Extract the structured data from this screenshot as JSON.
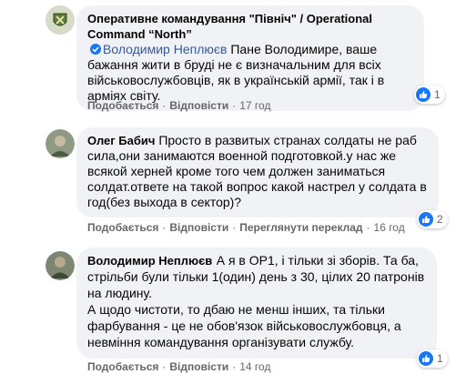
{
  "comments": [
    {
      "author": "Оперативне командування \"Північ\" / Operational Command “North”",
      "mention": "Володимир Неплюєв",
      "text": "Пане Володимире, ваше бажання жити в бруді не є визначальним для всіх військовослужбовців, як в українській армії, так і в арміях світу.",
      "actions": {
        "like": "Подобається",
        "reply": "Відповісти",
        "time": "17 год"
      },
      "reaction_count": "1",
      "avatar": "unit-emblem"
    },
    {
      "author": "Олег Бабич",
      "text": "Просто в развитых странах солдаты не раб сила,они занимаются военной подготовкой.у нас же всякой херней кроме того чем должен заниматься солдат.ответе на такой вопрос какой настрел у солдата в год(без выхода в сектор)?",
      "actions": {
        "like": "Подобається",
        "reply": "Відповісти",
        "translate": "Переглянути переклад",
        "time": "16 год"
      },
      "reaction_count": "2",
      "avatar": "user-photo"
    },
    {
      "author": "Володимир Неплюєв",
      "text": "А я в ОР1, і тільки зі зборів. Та ба, стрільби були тільки 1(один) день з 30, цілих 20 патронів на людину.\nА щодо чистоти, то дбаю не менш інших, та тільки фарбування - це не обов'язок військовослужбовця, а невміння командування організувати службу.",
      "actions": {
        "like": "Подобається",
        "reply": "Відповісти",
        "time": "14 год"
      },
      "reaction_count": "1",
      "avatar": "user-photo"
    }
  ],
  "colors": {
    "bubble": "#f0f2f5",
    "link": "#385898",
    "like": "#1877f2",
    "meta": "#65676b"
  }
}
